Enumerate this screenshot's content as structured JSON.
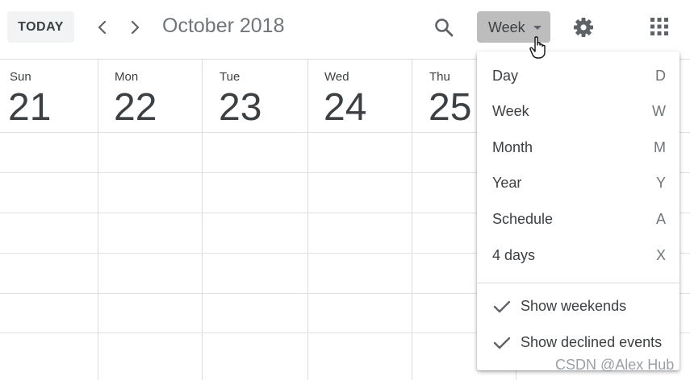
{
  "header": {
    "today_label": "TODAY",
    "prev_icon": "chevron-left-icon",
    "next_icon": "chevron-right-icon",
    "month_title": "October 2018",
    "search_icon": "search-icon",
    "view_selector": {
      "label": "Week",
      "icon": "caret-down-icon"
    },
    "settings_icon": "gear-icon",
    "apps_icon": "apps-grid-icon"
  },
  "days": [
    {
      "name": "Sun",
      "num": "21"
    },
    {
      "name": "Mon",
      "num": "22"
    },
    {
      "name": "Tue",
      "num": "23"
    },
    {
      "name": "Wed",
      "num": "24"
    },
    {
      "name": "Thu",
      "num": "25"
    }
  ],
  "view_menu": {
    "items": [
      {
        "label": "Day",
        "shortcut": "D"
      },
      {
        "label": "Week",
        "shortcut": "W"
      },
      {
        "label": "Month",
        "shortcut": "M"
      },
      {
        "label": "Year",
        "shortcut": "Y"
      },
      {
        "label": "Schedule",
        "shortcut": "A"
      },
      {
        "label": "4 days",
        "shortcut": "X"
      }
    ],
    "options": [
      {
        "label": "Show weekends",
        "checked": true
      },
      {
        "label": "Show declined events",
        "checked": true
      }
    ]
  },
  "watermark": "CSDN @Alex Hub",
  "colors": {
    "accent_gray": "#bdbdbd",
    "text": "#3c4043",
    "muted": "#70757a",
    "border": "#dadce0"
  }
}
